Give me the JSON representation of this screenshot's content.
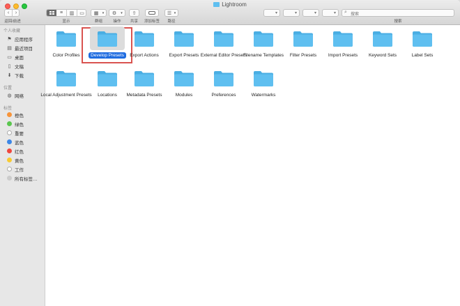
{
  "window": {
    "title": "Lightroom"
  },
  "toolbar": {
    "nav_label": "返回/前进",
    "view_label": "显示",
    "group_label": "群组",
    "action_label": "操作",
    "share_label": "共享",
    "tag_label": "添加标签",
    "path_label": "路径",
    "search_label": "搜索"
  },
  "sidebar": {
    "favorites_header": "个人收藏",
    "favorites": [
      {
        "label": "应用程序",
        "icon": "applications-icon"
      },
      {
        "label": "最近项目",
        "icon": "recents-icon"
      },
      {
        "label": "桌面",
        "icon": "desktop-icon"
      },
      {
        "label": "文稿",
        "icon": "documents-icon"
      },
      {
        "label": "下载",
        "icon": "downloads-icon"
      }
    ],
    "locations_header": "位置",
    "locations": [
      {
        "label": "网络",
        "icon": "network-icon"
      }
    ],
    "tags_header": "标签",
    "tags": [
      {
        "label": "橙色",
        "color": "#f7943a"
      },
      {
        "label": "绿色",
        "color": "#5ac64e"
      },
      {
        "label": "重要",
        "color": "#ffffff"
      },
      {
        "label": "蓝色",
        "color": "#3d87e6"
      },
      {
        "label": "红色",
        "color": "#f0473d"
      },
      {
        "label": "黄色",
        "color": "#f8cb32"
      },
      {
        "label": "工作",
        "color": "#ffffff"
      },
      {
        "label": "所有标签…",
        "color": "#cccccc"
      }
    ]
  },
  "folders": [
    {
      "label": "Color Profiles"
    },
    {
      "label": "Develop Presets",
      "selected": true
    },
    {
      "label": "Export Actions"
    },
    {
      "label": "Export Presets"
    },
    {
      "label": "External Editor Presets"
    },
    {
      "label": "Filename Templates"
    },
    {
      "label": "Filter Presets"
    },
    {
      "label": "Import Presets"
    },
    {
      "label": "Keyword Sets"
    },
    {
      "label": "Label Sets"
    },
    {
      "label": "Local Adjustment Presets"
    },
    {
      "label": "Locations"
    },
    {
      "label": "Metadata Presets"
    },
    {
      "label": "Modules"
    },
    {
      "label": "Preferences"
    },
    {
      "label": "Watermarks"
    }
  ],
  "colors": {
    "folder": "#5fbff0",
    "folder_dark": "#4aaee3",
    "selection": "#1f6ce0",
    "annotation": "#d9534f"
  }
}
